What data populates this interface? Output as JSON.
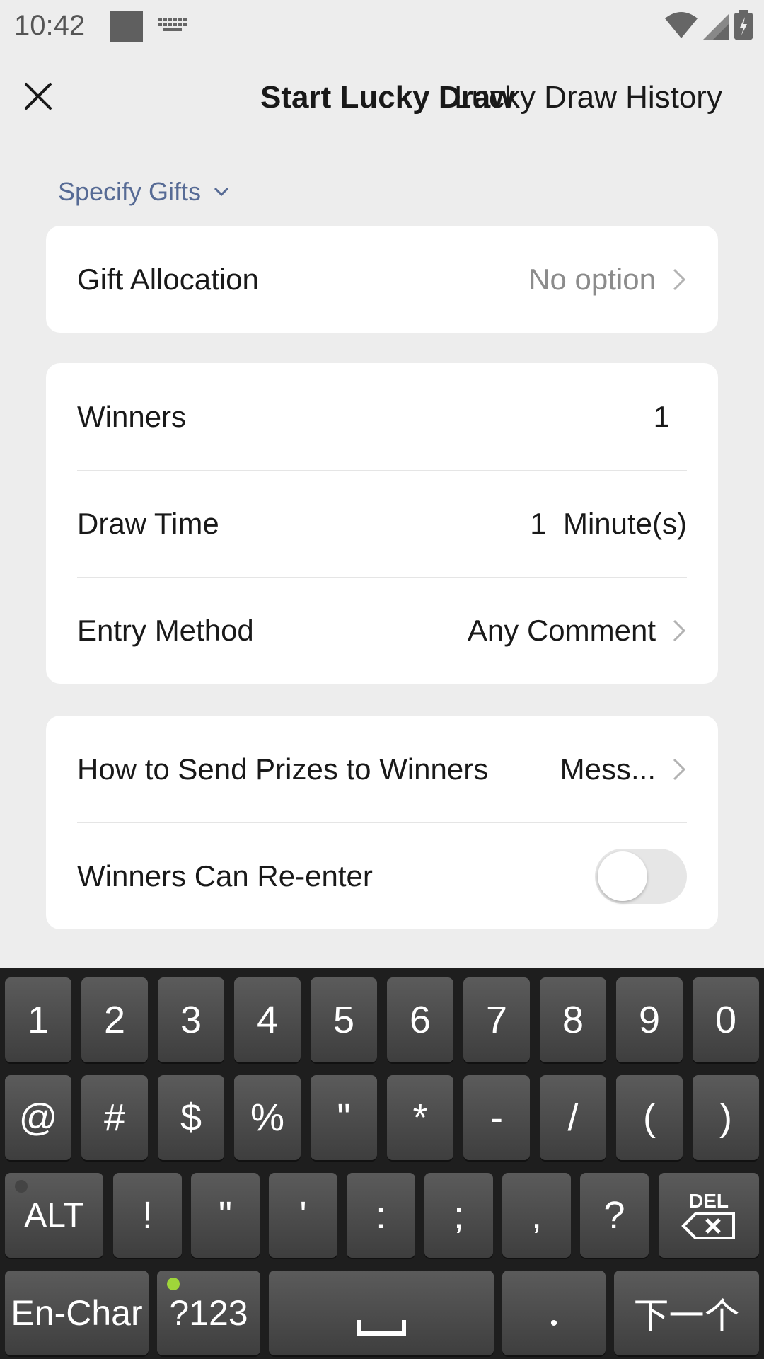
{
  "status_bar": {
    "time": "10:42"
  },
  "header": {
    "title_start": "Start Lucky Draw",
    "title_history": "Lucky Draw History"
  },
  "section": {
    "label": "Specify Gifts"
  },
  "card1": {
    "rows": [
      {
        "label": "Gift Allocation",
        "value": "No option"
      }
    ]
  },
  "card2": {
    "rows": [
      {
        "label": "Winners",
        "value": "1"
      },
      {
        "label": "Draw Time",
        "value": "1  Minute(s)"
      },
      {
        "label": "Entry Method",
        "value": "Any Comment"
      }
    ]
  },
  "card3": {
    "rows": [
      {
        "label": "How to Send Prizes to Winners",
        "value": "Mess..."
      },
      {
        "label": "Winners Can Re-enter",
        "toggle_on": false
      }
    ]
  },
  "keyboard": {
    "row1": [
      "1",
      "2",
      "3",
      "4",
      "5",
      "6",
      "7",
      "8",
      "9",
      "0"
    ],
    "row2": [
      "@",
      "#",
      "$",
      "%",
      "\"",
      "*",
      "-",
      "/",
      "(",
      ")"
    ],
    "row3": {
      "alt": "ALT",
      "keys": [
        "!",
        "\"",
        "'",
        ":",
        ";",
        ",",
        "?"
      ],
      "del": "DEL"
    },
    "row4": {
      "lang": "En-Char",
      "sym": "?123",
      "dot": "•",
      "next": "下一个"
    }
  },
  "colors": {
    "accent": "#576b95",
    "led_green": "#9fd63a",
    "led_off": "#444444"
  }
}
